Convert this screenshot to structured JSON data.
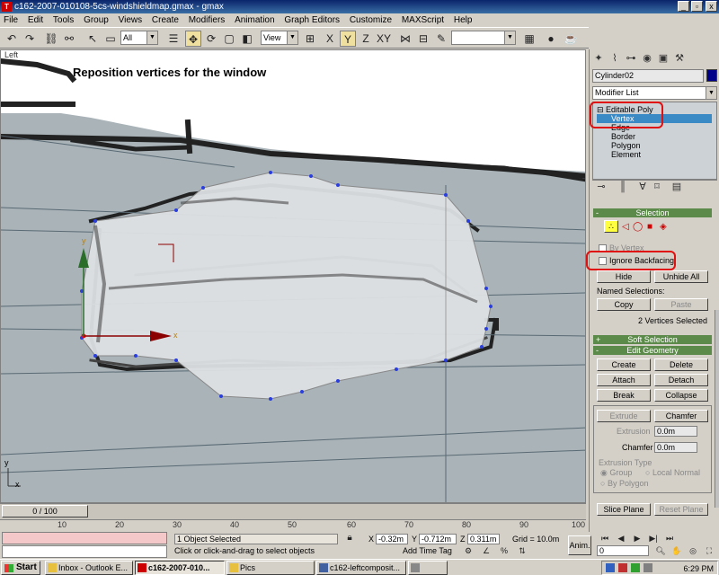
{
  "window": {
    "title": "c162-2007-010108-5cs-windshieldmap.gmax - gmax",
    "min": "_",
    "max": "▫",
    "close": "x"
  },
  "menu": [
    {
      "label": "File"
    },
    {
      "label": "Edit"
    },
    {
      "label": "Tools"
    },
    {
      "label": "Group"
    },
    {
      "label": "Views"
    },
    {
      "label": "Create"
    },
    {
      "label": "Modifiers"
    },
    {
      "label": "Animation"
    },
    {
      "label": "Graph Editors"
    },
    {
      "label": "Customize"
    },
    {
      "label": "MAXScript"
    },
    {
      "label": "Help"
    }
  ],
  "toolbar": {
    "filter_value": "All",
    "refcoord_value": "View",
    "named_set_value": ""
  },
  "viewport": {
    "label": "Left",
    "caption": "Reposition vertices for the window",
    "axis_y": "y",
    "axis_x": "x"
  },
  "command_panel": {
    "object_name": "Cylinder02",
    "object_color": "#00008b",
    "modifier_list": "Modifier List",
    "stack": [
      {
        "label": "Editable Poly",
        "selected": false
      },
      {
        "label": "Vertex",
        "selected": true
      },
      {
        "label": "Edge",
        "selected": false
      },
      {
        "label": "Border",
        "selected": false
      },
      {
        "label": "Polygon",
        "selected": false
      },
      {
        "label": "Element",
        "selected": false
      }
    ],
    "selection": {
      "title": "Selection",
      "by_vertex": "By Vertex",
      "ignore_backfacing": "Ignore Backfacing",
      "hide": "Hide",
      "unhide_all": "Unhide All",
      "named_selections": "Named Selections:",
      "copy": "Copy",
      "paste": "Paste",
      "status": "2 Vertices Selected"
    },
    "soft_selection": {
      "title": "Soft Selection"
    },
    "edit_geometry": {
      "title": "Edit Geometry",
      "create": "Create",
      "delete": "Delete",
      "attach": "Attach",
      "detach": "Detach",
      "break": "Break",
      "collapse": "Collapse",
      "extrude": "Extrude",
      "chamfer": "Chamfer",
      "extrusion_label": "Extrusion",
      "extrusion_value": "0.0m",
      "chamfer_label": "Chamfer",
      "chamfer_value": "0.0m",
      "extrusion_type": "Extrusion Type",
      "group": "Group",
      "local_normal": "Local Normal",
      "by_polygon": "By Polygon",
      "slice_plane": "Slice Plane",
      "reset_plane": "Reset Plane"
    }
  },
  "timeslider": {
    "thumb": "0 / 100"
  },
  "ruler": {
    "ticks": [
      "10",
      "20",
      "30",
      "40",
      "50",
      "60",
      "70",
      "80",
      "90",
      "100"
    ]
  },
  "status": {
    "selected": "1 Object Selected",
    "prompt": "Click or click-and-drag to select objects",
    "x_label": "X",
    "x_value": "-0.32m",
    "y_label": "Y",
    "y_value": "-0.712m",
    "z_label": "Z",
    "z_value": "0.311m",
    "grid": "Grid = 10.0m",
    "add_time_tag": "Add Time Tag",
    "anim": "Anim.",
    "frame": "0"
  },
  "taskbar": {
    "start": "Start",
    "items": [
      {
        "label": "Inbox - Outlook E..."
      },
      {
        "label": "c162-2007-010..."
      },
      {
        "label": "Pics"
      },
      {
        "label": "c162-leftcomposit..."
      },
      {
        "label": ""
      }
    ],
    "clock": "6:29 PM"
  }
}
